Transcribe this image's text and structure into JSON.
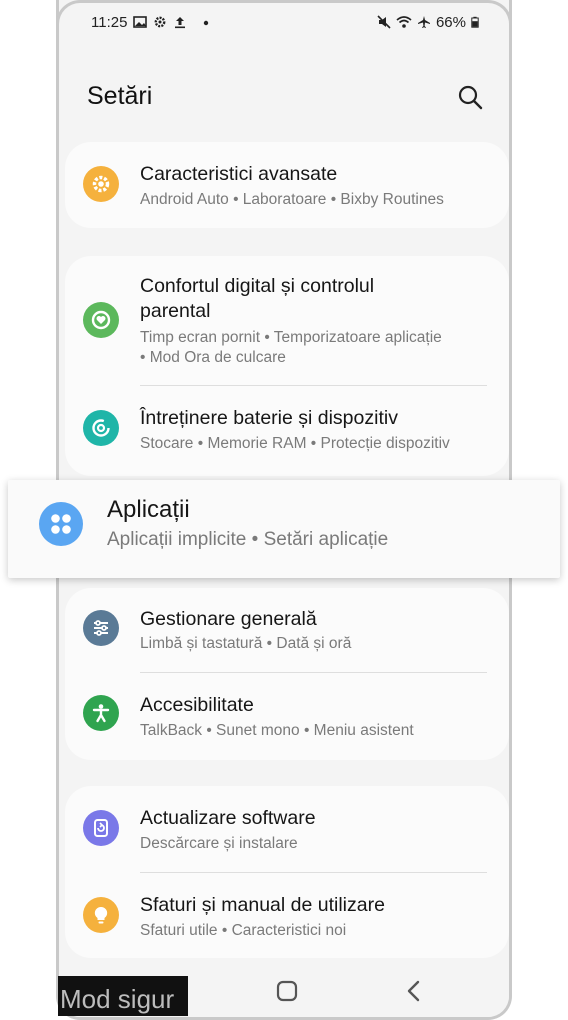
{
  "status_bar": {
    "time": "11:25",
    "left_icons": [
      "gallery-icon",
      "gear-icon",
      "upload-icon",
      "dot-icon"
    ],
    "right_icons": [
      "mute-icon",
      "wifi-icon",
      "airplane-icon",
      "battery-icon"
    ],
    "battery": "66%"
  },
  "header": {
    "title": "Setări",
    "search_icon": "search-icon"
  },
  "sections": [
    {
      "items": [
        {
          "title": "Caracteristici avansate",
          "subtitle": "Android Auto  •  Laboratoare  •  Bixby Routines",
          "icon": "gear-icon",
          "icon_color": "#f5b13d"
        }
      ]
    },
    {
      "items": [
        {
          "title_line1": "Confortul digital și controlul",
          "title_line2": "parental",
          "subtitle_line1": "Timp ecran pornit  •  Temporizatoare aplicație",
          "subtitle_line2": "•  Mod Ora de culcare",
          "icon": "heart-icon",
          "icon_color": "#5cb85c"
        },
        {
          "title": "Întreținere baterie și dispozitiv",
          "subtitle": "Stocare  •  Memorie RAM  •  Protecție dispozitiv",
          "icon": "device-care-icon",
          "icon_color": "#1fb5a8"
        }
      ]
    },
    {
      "items": [
        {
          "title": "Gestionare generală",
          "subtitle": "Limbă și tastatură  •  Dată și oră",
          "icon": "sliders-icon",
          "icon_color": "#5a7a96"
        },
        {
          "title": "Accesibilitate",
          "subtitle": "TalkBack  •  Sunet mono  •  Meniu asistent",
          "icon": "accessibility-icon",
          "icon_color": "#2fa44f"
        }
      ]
    },
    {
      "items": [
        {
          "title": "Actualizare software",
          "subtitle": "Descărcare și instalare",
          "icon": "update-icon",
          "icon_color": "#7a78e8"
        },
        {
          "title": "Sfaturi și manual de utilizare",
          "subtitle": "Sfaturi utile  •  Caracteristici noi",
          "icon": "lightbulb-icon",
          "icon_color": "#f5b13d"
        }
      ]
    }
  ],
  "highlighted": {
    "title": "Aplicații",
    "subtitle": "Aplicații implicite  •  Setări aplicație",
    "icon": "apps-icon",
    "icon_color": "#5aa6f2"
  },
  "nav_bar": {
    "buttons": [
      "recents-icon",
      "home-icon",
      "back-icon"
    ]
  },
  "safe_mode_label": "Mod sigur"
}
